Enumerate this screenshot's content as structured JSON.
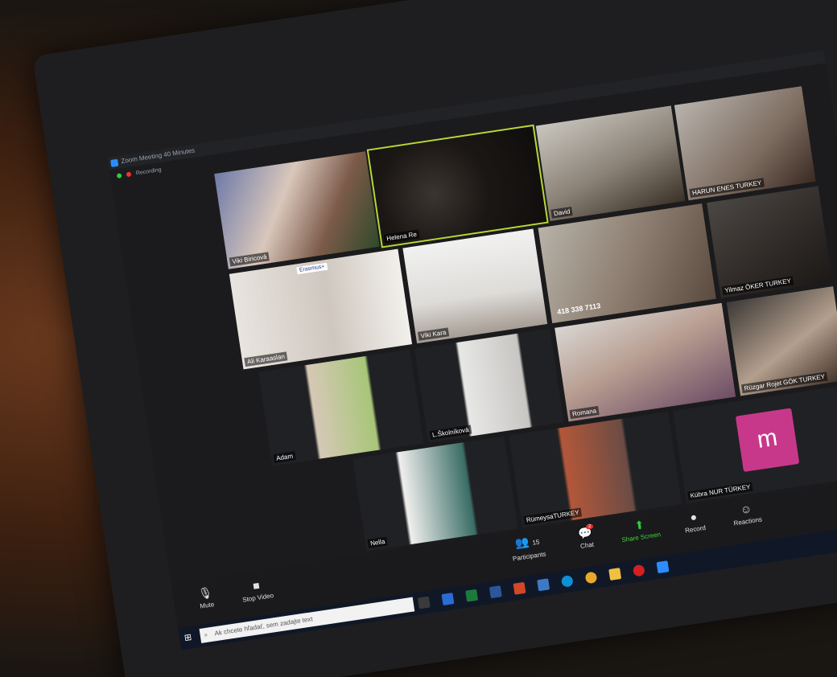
{
  "window": {
    "title": "Zoom Meeting 40 Minutes",
    "recording": "Recording"
  },
  "participants": [
    {
      "id": "viki-b",
      "name": "Viki Biricová"
    },
    {
      "id": "helena",
      "name": "Helena Re"
    },
    {
      "id": "david",
      "name": "David"
    },
    {
      "id": "harun",
      "name": "HARUN ENES  TURKEY"
    },
    {
      "id": "ali",
      "name": "Ali Karaaslan"
    },
    {
      "id": "viki-k",
      "name": "Viki Kara"
    },
    {
      "id": "phone",
      "name": "418 338 7113"
    },
    {
      "id": "yilmaz",
      "name": "Yilmaz ÖKER TURKEY"
    },
    {
      "id": "adam",
      "name": "Adam"
    },
    {
      "id": "skolnikova",
      "name": "L.Školníková"
    },
    {
      "id": "romana",
      "name": "Romana"
    },
    {
      "id": "ruzgar",
      "name": "Rüzgar Rojet GÖK TURKEY"
    },
    {
      "id": "nella",
      "name": "Nella"
    },
    {
      "id": "rumeysa",
      "name": "RümeysaTURKEY"
    },
    {
      "id": "kubra",
      "name": "Kübra NUR TÜRKEY",
      "avatar_letter": "m"
    }
  ],
  "erasmus_label": "Erasmus+",
  "toolbar": {
    "mute": "Mute",
    "stop_video": "Stop Video",
    "participants_label": "Participants",
    "participants_count": "15",
    "chat": "Chat",
    "chat_badge": "2",
    "share_screen": "Share Screen",
    "record": "Record",
    "reactions": "Reactions"
  },
  "taskbar": {
    "search_placeholder": "Ak chcete hľadať, sem zadajte text"
  },
  "colors": {
    "background": "#5d6af5",
    "share_green": "#3cd43c",
    "avatar_pink": "#c8388a",
    "highlight": "#b8d833"
  }
}
